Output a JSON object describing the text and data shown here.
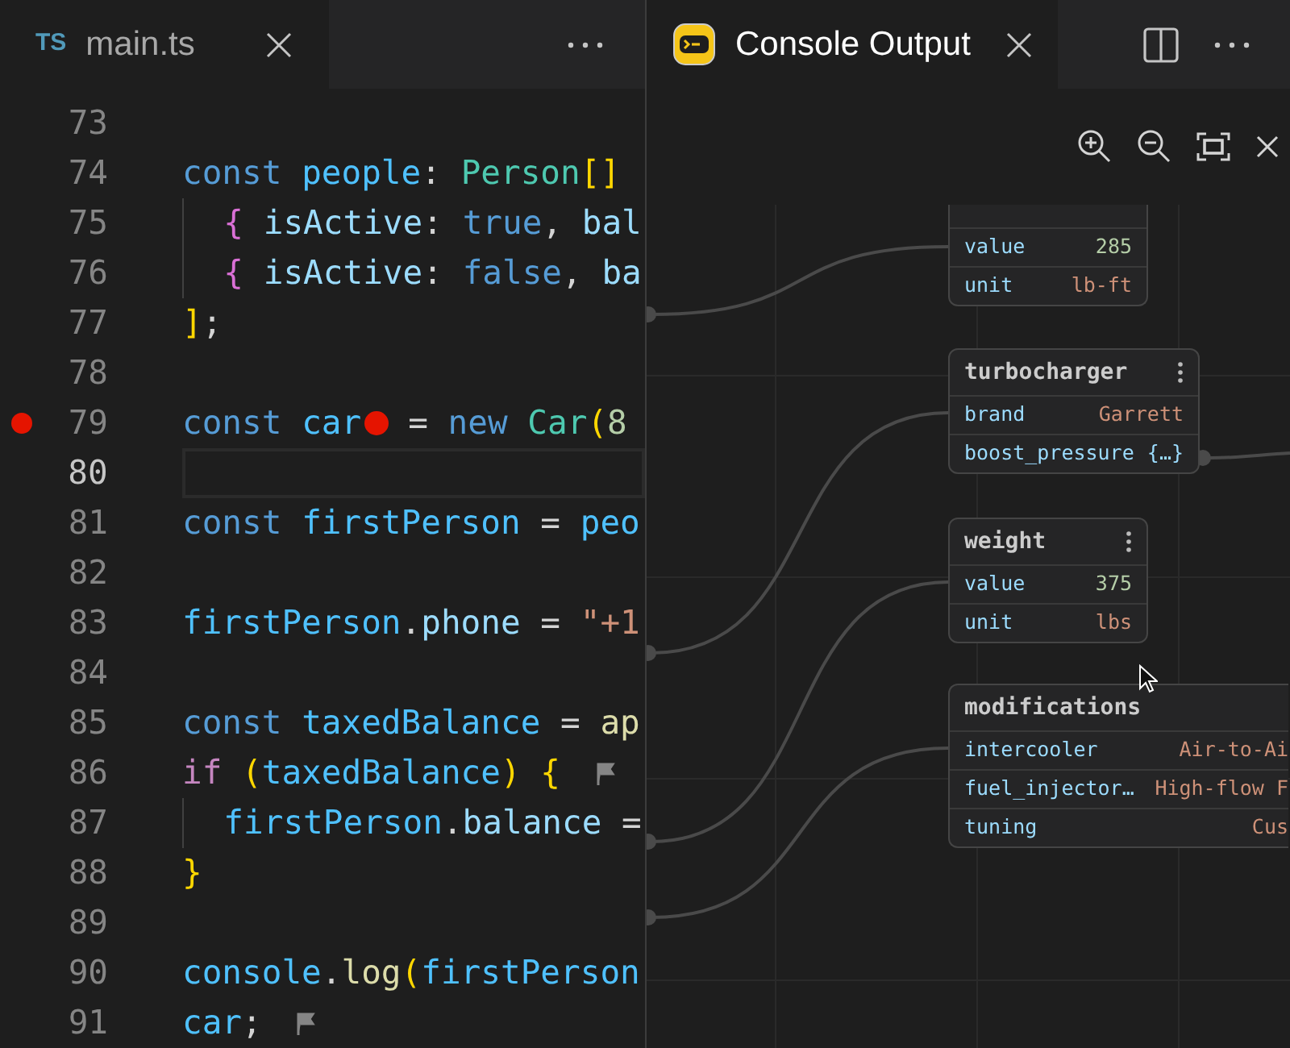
{
  "editor": {
    "tab": {
      "icon_text": "TS",
      "label": "main.ts",
      "selected": true
    },
    "lines": [
      {
        "number": "73",
        "current": false,
        "breakpoint": false,
        "indent_guide": false
      },
      {
        "number": "74",
        "current": false,
        "breakpoint": false,
        "indent_guide": false,
        "segments": [
          {
            "kind": "code",
            "tokens": [
              {
                "text": "const ",
                "kind": "keyword"
              },
              {
                "text": "people",
                "kind": "variable"
              },
              {
                "text": ": ",
                "kind": "plain"
              },
              {
                "text": "Person",
                "kind": "type"
              },
              {
                "text": "[]",
                "kind": "bracket"
              }
            ]
          }
        ]
      },
      {
        "number": "75",
        "current": false,
        "breakpoint": false,
        "indent_guide": true,
        "segments": [
          {
            "kind": "code",
            "tokens": [
              {
                "text": "  {",
                "kind": "bracket2"
              },
              {
                "text": " isActive",
                "kind": "property"
              },
              {
                "text": ": ",
                "kind": "plain"
              },
              {
                "text": "true",
                "kind": "keyword"
              },
              {
                "text": ", ",
                "kind": "plain"
              },
              {
                "text": "bal",
                "kind": "property"
              }
            ]
          }
        ]
      },
      {
        "number": "76",
        "current": false,
        "breakpoint": false,
        "indent_guide": true,
        "segments": [
          {
            "kind": "code",
            "tokens": [
              {
                "text": "  {",
                "kind": "bracket2"
              },
              {
                "text": " isActive",
                "kind": "property"
              },
              {
                "text": ": ",
                "kind": "plain"
              },
              {
                "text": "false",
                "kind": "keyword"
              },
              {
                "text": ", ",
                "kind": "plain"
              },
              {
                "text": "ba",
                "kind": "property"
              }
            ]
          }
        ]
      },
      {
        "number": "77",
        "current": false,
        "breakpoint": false,
        "indent_guide": false,
        "segments": [
          {
            "kind": "code",
            "tokens": [
              {
                "text": "]",
                "kind": "bracket"
              },
              {
                "text": ";",
                "kind": "plain"
              }
            ]
          }
        ]
      },
      {
        "number": "78",
        "current": false,
        "breakpoint": false,
        "indent_guide": false
      },
      {
        "number": "79",
        "current": false,
        "breakpoint": true,
        "indent_guide": false,
        "segments": [
          {
            "kind": "code",
            "tokens": [
              {
                "text": "const ",
                "kind": "keyword"
              },
              {
                "text": "car",
                "kind": "variable"
              }
            ]
          },
          {
            "kind": "inline-breakpoint"
          },
          {
            "kind": "code",
            "tokens": [
              {
                "text": "= ",
                "kind": "plain"
              },
              {
                "text": "new ",
                "kind": "keyword"
              },
              {
                "text": "Car",
                "kind": "type"
              },
              {
                "text": "(",
                "kind": "bracket"
              },
              {
                "text": "8",
                "kind": "number"
              }
            ]
          }
        ]
      },
      {
        "number": "80",
        "current": true,
        "breakpoint": false,
        "indent_guide": false
      },
      {
        "number": "81",
        "current": false,
        "breakpoint": false,
        "indent_guide": false,
        "segments": [
          {
            "kind": "code",
            "tokens": [
              {
                "text": "const ",
                "kind": "keyword"
              },
              {
                "text": "firstPerson",
                "kind": "variable"
              },
              {
                "text": " = ",
                "kind": "plain"
              },
              {
                "text": "peo",
                "kind": "variable"
              }
            ]
          }
        ]
      },
      {
        "number": "82",
        "current": false,
        "breakpoint": false,
        "indent_guide": false
      },
      {
        "number": "83",
        "current": false,
        "breakpoint": false,
        "indent_guide": false,
        "segments": [
          {
            "kind": "code",
            "tokens": [
              {
                "text": "firstPerson",
                "kind": "variable"
              },
              {
                "text": ".",
                "kind": "plain"
              },
              {
                "text": "phone",
                "kind": "property"
              },
              {
                "text": " = ",
                "kind": "plain"
              },
              {
                "text": "\"+1",
                "kind": "string"
              }
            ]
          }
        ]
      },
      {
        "number": "84",
        "current": false,
        "breakpoint": false,
        "indent_guide": false
      },
      {
        "number": "85",
        "current": false,
        "breakpoint": false,
        "indent_guide": false,
        "segments": [
          {
            "kind": "code",
            "tokens": [
              {
                "text": "const ",
                "kind": "keyword"
              },
              {
                "text": "taxedBalance",
                "kind": "variable"
              },
              {
                "text": " = ",
                "kind": "plain"
              },
              {
                "text": "ap",
                "kind": "function"
              }
            ]
          }
        ]
      },
      {
        "number": "86",
        "current": false,
        "breakpoint": false,
        "indent_guide": false,
        "segments": [
          {
            "kind": "code",
            "tokens": [
              {
                "text": "if ",
                "kind": "control"
              },
              {
                "text": "(",
                "kind": "bracket"
              },
              {
                "text": "taxedBalance",
                "kind": "variable"
              },
              {
                "text": ")",
                "kind": "bracket"
              },
              {
                "text": " {",
                "kind": "bracket"
              }
            ]
          },
          {
            "kind": "flag"
          }
        ]
      },
      {
        "number": "87",
        "current": false,
        "breakpoint": false,
        "indent_guide": true,
        "segments": [
          {
            "kind": "code",
            "tokens": [
              {
                "text": "  firstPerson",
                "kind": "variable"
              },
              {
                "text": ".",
                "kind": "plain"
              },
              {
                "text": "balance",
                "kind": "property"
              },
              {
                "text": " =",
                "kind": "plain"
              }
            ]
          }
        ]
      },
      {
        "number": "88",
        "current": false,
        "breakpoint": false,
        "indent_guide": false,
        "segments": [
          {
            "kind": "code",
            "tokens": [
              {
                "text": "}",
                "kind": "bracket"
              }
            ]
          }
        ]
      },
      {
        "number": "89",
        "current": false,
        "breakpoint": false,
        "indent_guide": false
      },
      {
        "number": "90",
        "current": false,
        "breakpoint": false,
        "indent_guide": false,
        "segments": [
          {
            "kind": "code",
            "tokens": [
              {
                "text": "console",
                "kind": "variable"
              },
              {
                "text": ".",
                "kind": "plain"
              },
              {
                "text": "log",
                "kind": "function"
              },
              {
                "text": "(",
                "kind": "bracket"
              },
              {
                "text": "firstPerson",
                "kind": "variable"
              }
            ]
          }
        ]
      },
      {
        "number": "91",
        "current": false,
        "breakpoint": false,
        "indent_guide": false,
        "segments": [
          {
            "kind": "code",
            "tokens": [
              {
                "text": "car",
                "kind": "variable"
              },
              {
                "text": ";",
                "kind": "plain"
              }
            ]
          },
          {
            "kind": "flag"
          }
        ]
      }
    ]
  },
  "console": {
    "tab": {
      "label": "Console Output",
      "selected": true
    },
    "nodes": [
      {
        "menu": false,
        "rows": [
          {
            "key": "value",
            "value": "285",
            "kind": "number"
          },
          {
            "key": "unit",
            "value": "lb-ft",
            "kind": "string"
          }
        ]
      },
      {
        "title": "turbocharger",
        "menu": true,
        "rows": [
          {
            "key": "brand",
            "value": "Garrett",
            "kind": "string"
          },
          {
            "key": "boost_pressure",
            "value": "{…}",
            "kind": "object"
          }
        ]
      },
      {
        "title": "weight",
        "menu": true,
        "rows": [
          {
            "key": "value",
            "value": "375",
            "kind": "number"
          },
          {
            "key": "unit",
            "value": "lbs",
            "kind": "string"
          }
        ]
      },
      {
        "title": "modifications",
        "menu": false,
        "rows": [
          {
            "key": "intercooler",
            "value": "Air-to-Ai",
            "kind": "string"
          },
          {
            "key": "fuel_injector…",
            "value": "High-flow F",
            "kind": "string"
          },
          {
            "key": "tuning",
            "value": "Cus",
            "kind": "string"
          }
        ]
      }
    ]
  }
}
